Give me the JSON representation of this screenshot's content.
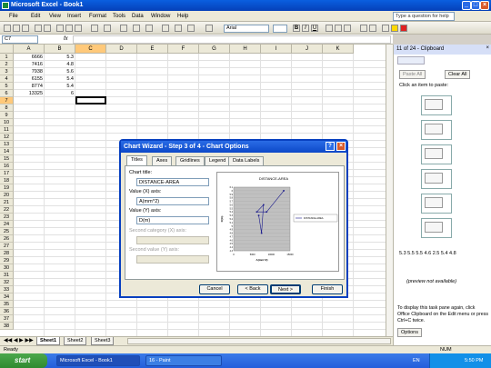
{
  "window": {
    "title": "Microsoft Excel - Book1"
  },
  "menu": [
    "File",
    "Edit",
    "View",
    "Insert",
    "Format",
    "Tools",
    "Data",
    "Window",
    "Help"
  ],
  "ask_placeholder": "Type a question for help",
  "toolbar": {
    "font": "Arial",
    "size": "10"
  },
  "formula": {
    "namebox": "C7",
    "fx": "fx"
  },
  "columns": [
    "A",
    "B",
    "C",
    "D",
    "E",
    "F",
    "G",
    "H",
    "I",
    "J",
    "K"
  ],
  "rows": [
    "1",
    "2",
    "3",
    "4",
    "5",
    "6",
    "7",
    "8",
    "9",
    "10",
    "11",
    "12",
    "13",
    "14",
    "15",
    "16",
    "17",
    "18",
    "19",
    "20",
    "21",
    "22",
    "23",
    "24",
    "25",
    "26",
    "27",
    "28",
    "29",
    "30",
    "31",
    "32",
    "33",
    "34",
    "35",
    "36",
    "37",
    "38"
  ],
  "cells": [
    {
      "a": "6666",
      "b": "5.3"
    },
    {
      "a": "7416",
      "b": "4.8"
    },
    {
      "a": "7938",
      "b": "5.6"
    },
    {
      "a": "6155",
      "b": "5.4"
    },
    {
      "a": "8774",
      "b": "5.4"
    },
    {
      "a": "13325",
      "b": "6"
    }
  ],
  "sheets": [
    "Sheet1",
    "Sheet2",
    "Sheet3"
  ],
  "status": {
    "left": "Ready",
    "num": "NUM"
  },
  "taskbar": {
    "start": "start",
    "tasks": [
      "Microsoft Excel - Book1",
      "16 - Paint"
    ],
    "lang": "EN",
    "time": "5:50 PM"
  },
  "clipboard": {
    "title": "11 of 24 - Clipboard",
    "paste_all": "Paste All",
    "clear_all": "Clear All",
    "instruction": "Click an item to paste:",
    "text_item": "5.3 5.5 5.5 4.6 2.5 5.4 4.8",
    "preview_na": "(preview not available)",
    "footer": "To display this task pane again, click Office Clipboard on the Edit menu or press Ctrl+C twice.",
    "options": "Options"
  },
  "dialog": {
    "title": "Chart Wizard - Step 3 of 4 - Chart Options",
    "tabs": [
      "Titles",
      "Axes",
      "Gridlines",
      "Legend",
      "Data Labels"
    ],
    "chart_title_label": "Chart title:",
    "chart_title_value": "DISTANCE-AREA",
    "xaxis_label": "Value (X) axis:",
    "xaxis_value": "A(mm^2)",
    "yaxis_label": "Value (Y) axis:",
    "yaxis_value": "D(m)",
    "second_x_label": "Second category (X) axis:",
    "second_y_label": "Second value (Y) axis:",
    "buttons": [
      "Cancel",
      "< Back",
      "Next >",
      "Finish"
    ]
  },
  "chart_data": {
    "type": "line",
    "title": "DISTANCE-AREA",
    "xlabel": "A(mm^2)",
    "ylabel": "D(m)",
    "legend": "DISTANCE-AREA",
    "x": [
      6666,
      7416,
      7938,
      6155,
      8774,
      13325
    ],
    "y": [
      5.3,
      4.8,
      5.6,
      5.4,
      5.4,
      6
    ],
    "xlim": [
      0,
      15000
    ],
    "ylim": [
      4.3,
      6.1
    ],
    "xticks": [
      "0",
      "5000",
      "10000",
      "15000"
    ],
    "yticks": [
      "6.1",
      "6",
      "5.9",
      "5.8",
      "5.7",
      "5.6",
      "5.5",
      "5.4",
      "5.3",
      "5.2",
      "5.1",
      "5",
      "4.9",
      "4.8",
      "4.7",
      "4.6",
      "4.5",
      "4.4",
      "4.3"
    ],
    "legend_position": "right"
  }
}
